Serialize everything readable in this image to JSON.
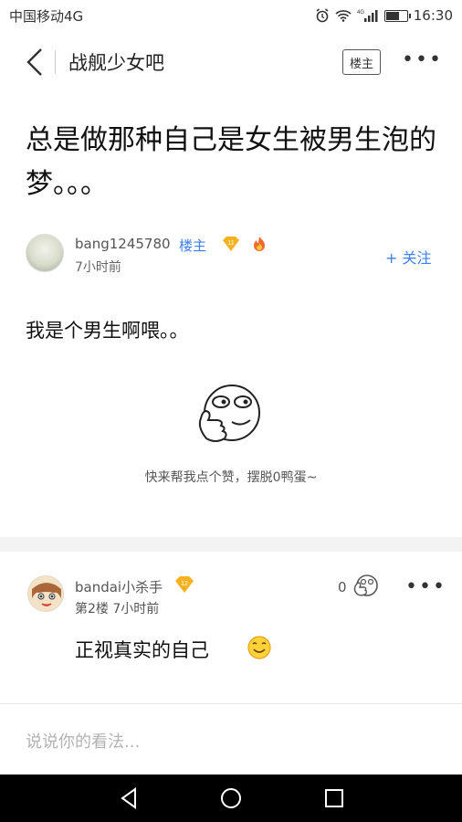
{
  "status_bar": {
    "carrier": "中国移动4G",
    "time": "16:30",
    "signal_label": "4G"
  },
  "nav": {
    "title": "战舰少女吧",
    "louzhu_button": "楼主",
    "more": "•••"
  },
  "post": {
    "title": "总是做那种自己是女生被男生泡的梦。。。",
    "author": "bang1245780",
    "author_tag": "楼主",
    "level_badge": "11",
    "time": "7小时前",
    "follow": "+ 关注",
    "body": "我是个男生啊喂。。",
    "zan_hint": "快来帮我点个赞，摆脱0鸭蛋~"
  },
  "reply": {
    "author": "bandai小杀手",
    "level_badge": "12",
    "floor_time": "第2楼  7小时前",
    "like_count": "0",
    "more": "•••",
    "text": "正视真实的自己"
  },
  "comment_box": {
    "placeholder": "说说你的看法..."
  },
  "colors": {
    "accent_blue": "#3c7ff0",
    "badge_gold": "#f5b21e",
    "badge_fire": "#f06a2a",
    "divider": "#f3f3f3"
  }
}
